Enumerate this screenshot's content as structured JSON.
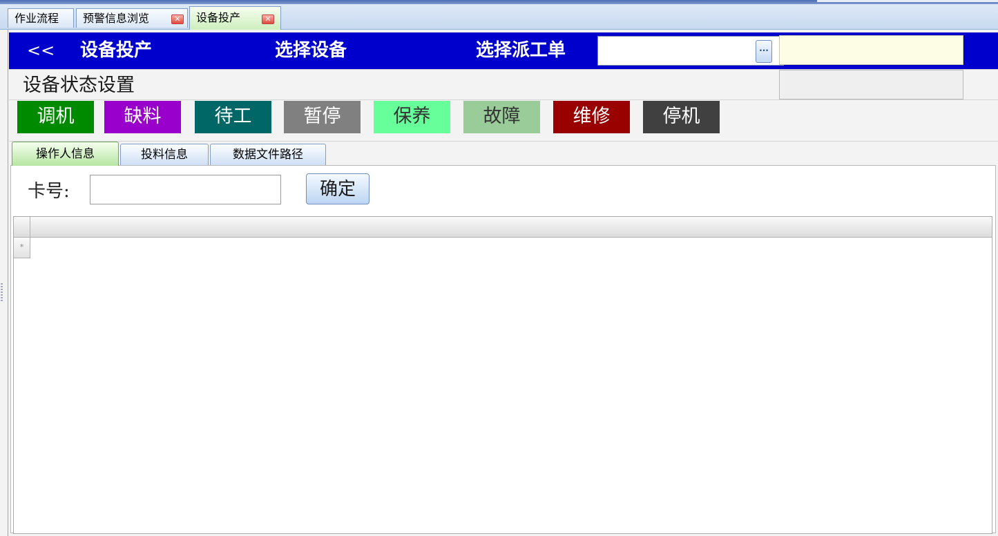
{
  "doc_tabs": [
    {
      "label": "作业流程",
      "closable": false
    },
    {
      "label": "预警信息浏览",
      "closable": true
    },
    {
      "label": "设备投产",
      "closable": true,
      "active": true
    }
  ],
  "close_glyph": "✕",
  "header": {
    "back_label": "<<",
    "title": "设备投产",
    "select_device_label": "选择设备",
    "select_order_label": "选择派工单",
    "order_combo_value": "",
    "combo_button_label": "···",
    "bg_color": "#0000cc"
  },
  "status_section": {
    "title": "设备状态设置",
    "buttons": [
      {
        "label": "调机",
        "bg": "#008a00",
        "fg": "#ffffff"
      },
      {
        "label": "缺料",
        "bg": "#9900cc",
        "fg": "#ffffff"
      },
      {
        "label": "待工",
        "bg": "#006666",
        "fg": "#ffffff"
      },
      {
        "label": "暂停",
        "bg": "#808080",
        "fg": "#ffffff"
      },
      {
        "label": "保养",
        "bg": "#66ff99",
        "fg": "#333333"
      },
      {
        "label": "故障",
        "bg": "#99cc99",
        "fg": "#333333"
      },
      {
        "label": "维修",
        "bg": "#990000",
        "fg": "#ffffff"
      },
      {
        "label": "停机",
        "bg": "#404040",
        "fg": "#ffffff"
      }
    ]
  },
  "inner_tabs": [
    {
      "label": "操作人信息",
      "active": true
    },
    {
      "label": "投料信息",
      "active": false
    },
    {
      "label": "数据文件路径",
      "active": false
    }
  ],
  "operator_panel": {
    "card_label": "卡号:",
    "card_value": "",
    "confirm_label": "确定"
  },
  "grid": {
    "new_row_marker": "*"
  }
}
